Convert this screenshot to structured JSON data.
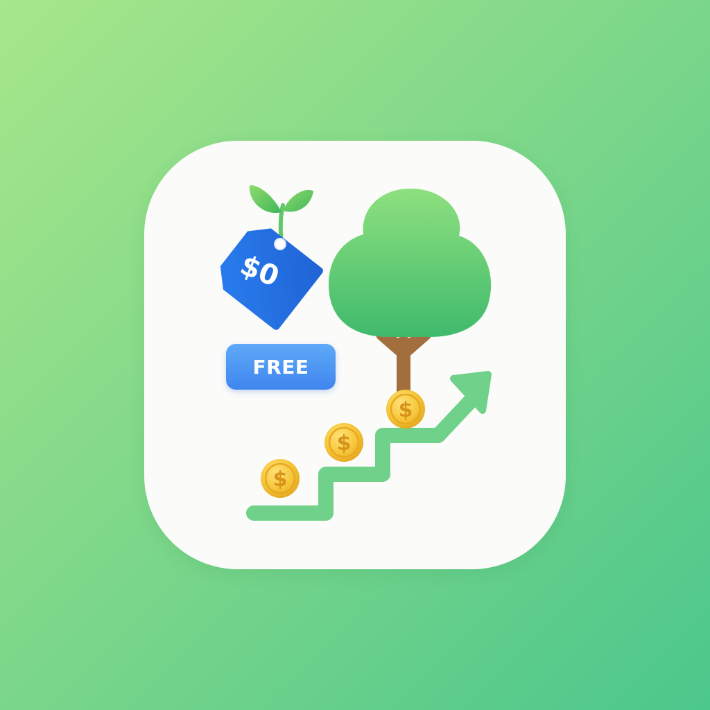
{
  "icon": {
    "free_label": "FREE",
    "price_tag_text": "$0",
    "coin_symbol": "$",
    "coins": [
      {
        "symbol": "$"
      },
      {
        "symbol": "$"
      },
      {
        "symbol": "$"
      }
    ],
    "icons": [
      "price-tag-icon",
      "sprout-icon",
      "tree-icon",
      "coin-icon",
      "growth-arrow-icon"
    ]
  },
  "colors": {
    "background_start": "#a7e68a",
    "background_end": "#4cc78c",
    "card": "#fbfbf9",
    "tag_blue": "#2f73e0",
    "badge_blue": "#4a94f2",
    "leaf_green": "#4fc468",
    "tree_green": "#5fce78",
    "trunk_brown": "#a26e3e",
    "coin_gold": "#f2bd2c",
    "arrow_green": "#6fd18a"
  }
}
